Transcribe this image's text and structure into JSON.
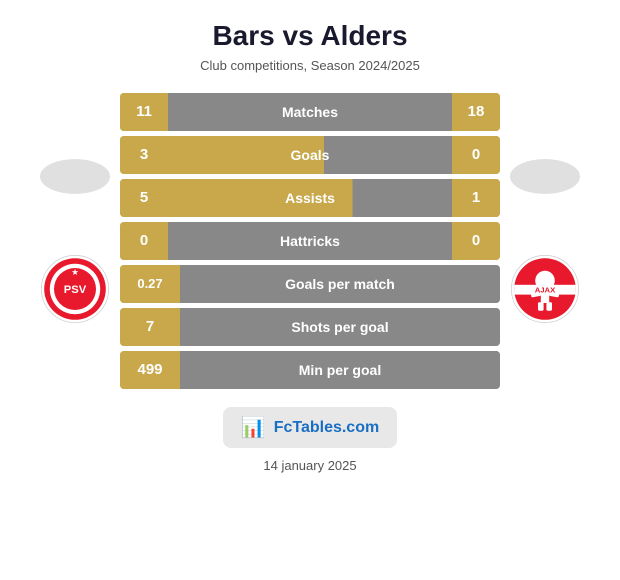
{
  "header": {
    "title": "Bars vs Alders",
    "subtitle": "Club competitions, Season 2024/2025"
  },
  "stats": [
    {
      "id": "matches",
      "label": "Matches",
      "left": "11",
      "right": "18",
      "type": "both"
    },
    {
      "id": "goals",
      "label": "Goals",
      "left": "3",
      "right": "0",
      "type": "both"
    },
    {
      "id": "assists",
      "label": "Assists",
      "left": "5",
      "right": "1",
      "type": "both"
    },
    {
      "id": "hattricks",
      "label": "Hattricks",
      "left": "0",
      "right": "0",
      "type": "both"
    },
    {
      "id": "goals-per-match",
      "label": "Goals per match",
      "left": "0.27",
      "right": "",
      "type": "single"
    },
    {
      "id": "shots-per-goal",
      "label": "Shots per goal",
      "left": "7",
      "right": "",
      "type": "single"
    },
    {
      "id": "min-per-goal",
      "label": "Min per goal",
      "left": "499",
      "right": "",
      "type": "single"
    }
  ],
  "badge": {
    "icon": "📊",
    "text": "FcTables.com"
  },
  "footer": {
    "date": "14 january 2025"
  }
}
